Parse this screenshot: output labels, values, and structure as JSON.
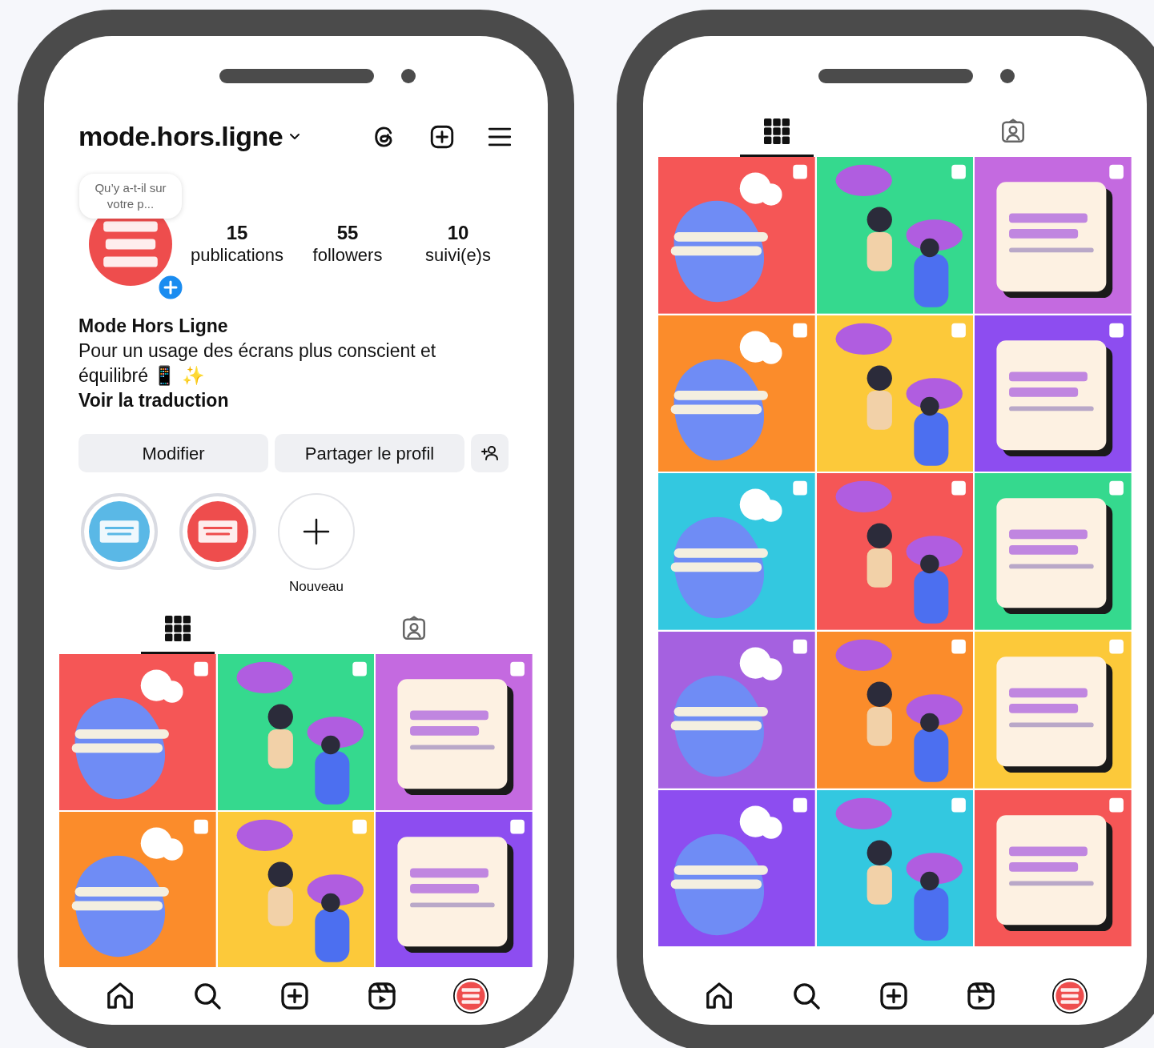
{
  "left_phone": {
    "profile": {
      "username": "mode.hors.ligne",
      "note": "Qu’y a-t-il sur votre p...",
      "stats": [
        {
          "value": "15",
          "label": "publications"
        },
        {
          "value": "55",
          "label": "followers"
        },
        {
          "value": "10",
          "label": "suivi(e)s"
        }
      ],
      "name": "Mode Hors Ligne",
      "bio": "Pour un usage des écrans plus conscient et équilibré 📱 ✨",
      "translate": "Voir la traduction",
      "buttons": [
        "Modifier",
        "Partager le profil"
      ]
    },
    "highlights": [
      {
        "kind": "picture",
        "color": "#5ab8e6"
      },
      {
        "kind": "picture",
        "color": "#ee4d4d"
      },
      {
        "kind": "new",
        "label": "Nouveau"
      }
    ],
    "tabs": [
      {
        "selected": true
      },
      {
        "selected": false
      }
    ],
    "posts": [
      {
        "color": "#f55656"
      },
      {
        "color": "#35d98e"
      },
      {
        "color": "#c46ae0"
      },
      {
        "color": "#fb8c2b"
      },
      {
        "color": "#fcc93a"
      },
      {
        "color": "#8d4df0"
      }
    ]
  },
  "right_phone": {
    "tabs": [
      {
        "selected": true
      },
      {
        "selected": false
      }
    ],
    "posts": [
      {
        "color": "#f55656"
      },
      {
        "color": "#35d98e"
      },
      {
        "color": "#c46ae0"
      },
      {
        "color": "#fb8c2b"
      },
      {
        "color": "#fcc93a"
      },
      {
        "color": "#8d4df0"
      },
      {
        "color": "#33c8e0"
      },
      {
        "color": "#f55656"
      },
      {
        "color": "#35d98e"
      },
      {
        "color": "#a561e0"
      },
      {
        "color": "#fb8c2b"
      },
      {
        "color": "#fcc93a"
      },
      {
        "color": "#8d4df0"
      },
      {
        "color": "#33c8e0"
      },
      {
        "color": "#f55656"
      }
    ]
  }
}
